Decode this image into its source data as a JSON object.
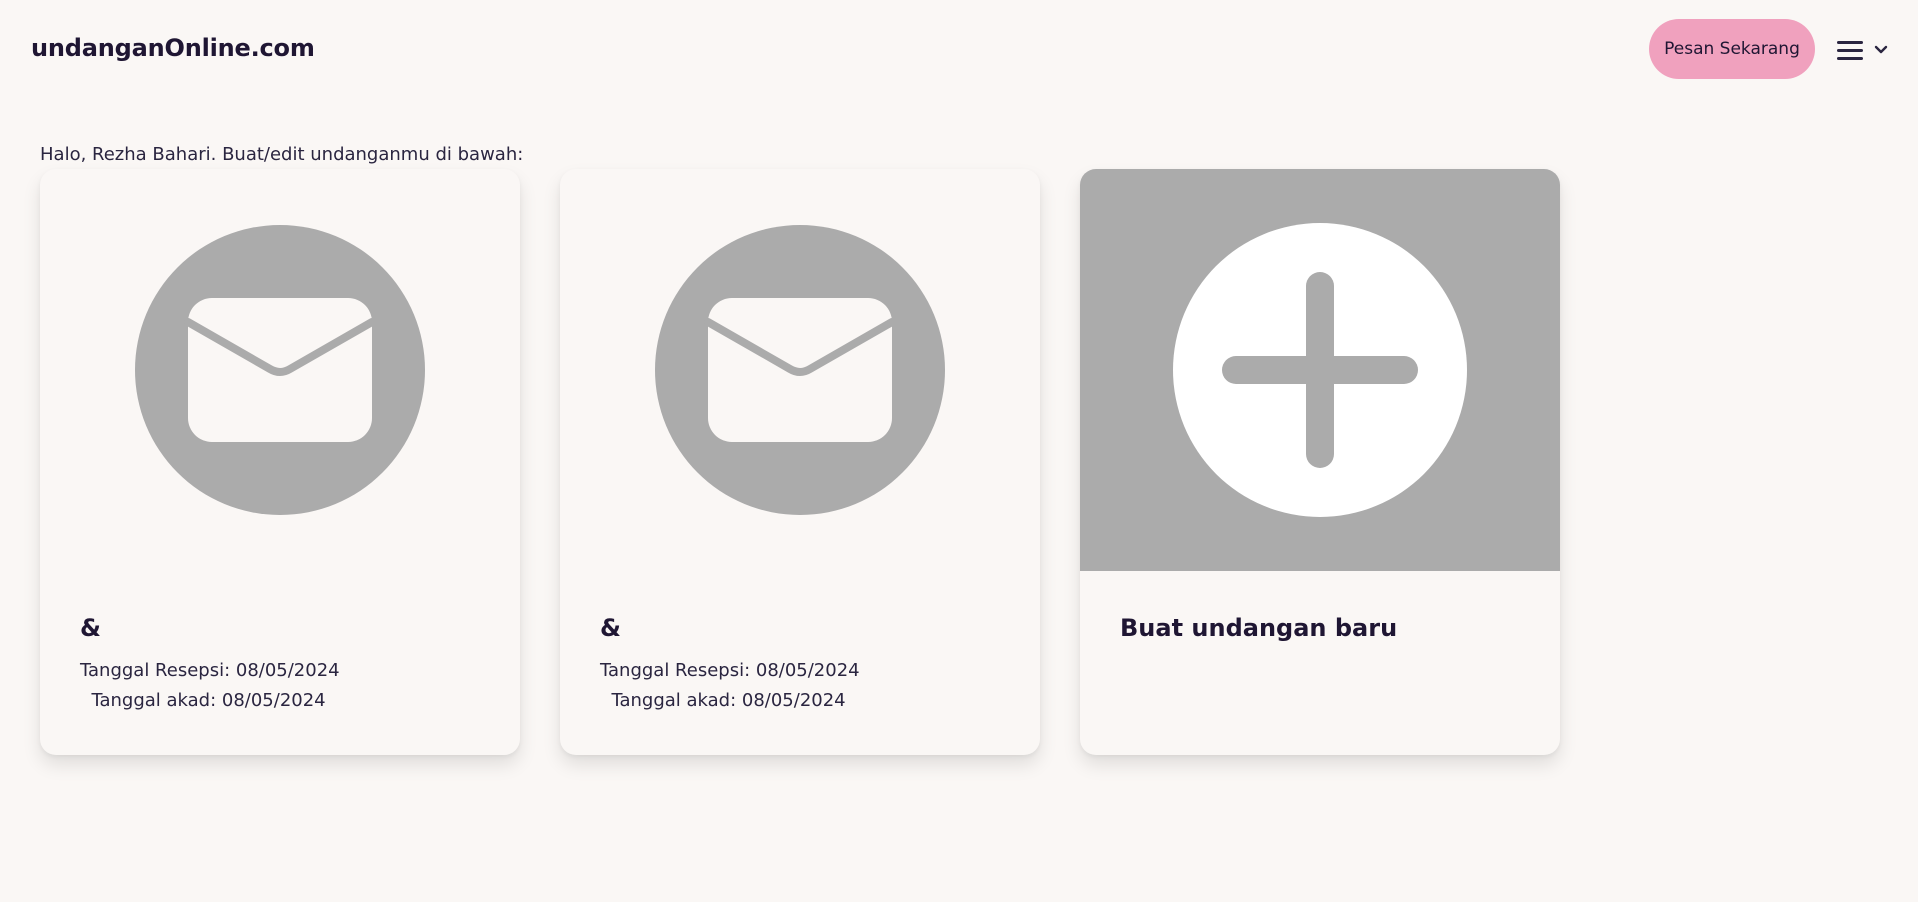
{
  "header": {
    "brand": "undanganOnline.com",
    "cta_label": "Pesan Sekarang",
    "menu_icon": "hamburger-menu-icon",
    "dropdown_icon": "chevron-down-icon"
  },
  "main": {
    "greeting": "Halo, Rezha Bahari. Buat/edit undanganmu di bawah:",
    "invitations": [
      {
        "icon": "envelope-icon",
        "couple": "&",
        "reception_label": "Tanggal Resepsi: 08/05/2024",
        "akad_label": "  Tanggal akad: 08/05/2024"
      },
      {
        "icon": "envelope-icon",
        "couple": "&",
        "reception_label": "Tanggal Resepsi: 08/05/2024",
        "akad_label": "  Tanggal akad: 08/05/2024"
      }
    ],
    "new_card": {
      "icon": "plus-circle-icon",
      "label": "Buat undangan baru"
    }
  },
  "colors": {
    "background": "#faf7f5",
    "accent": "#f0a1be",
    "icon_gray": "#ababab",
    "text": "#1f1633"
  }
}
